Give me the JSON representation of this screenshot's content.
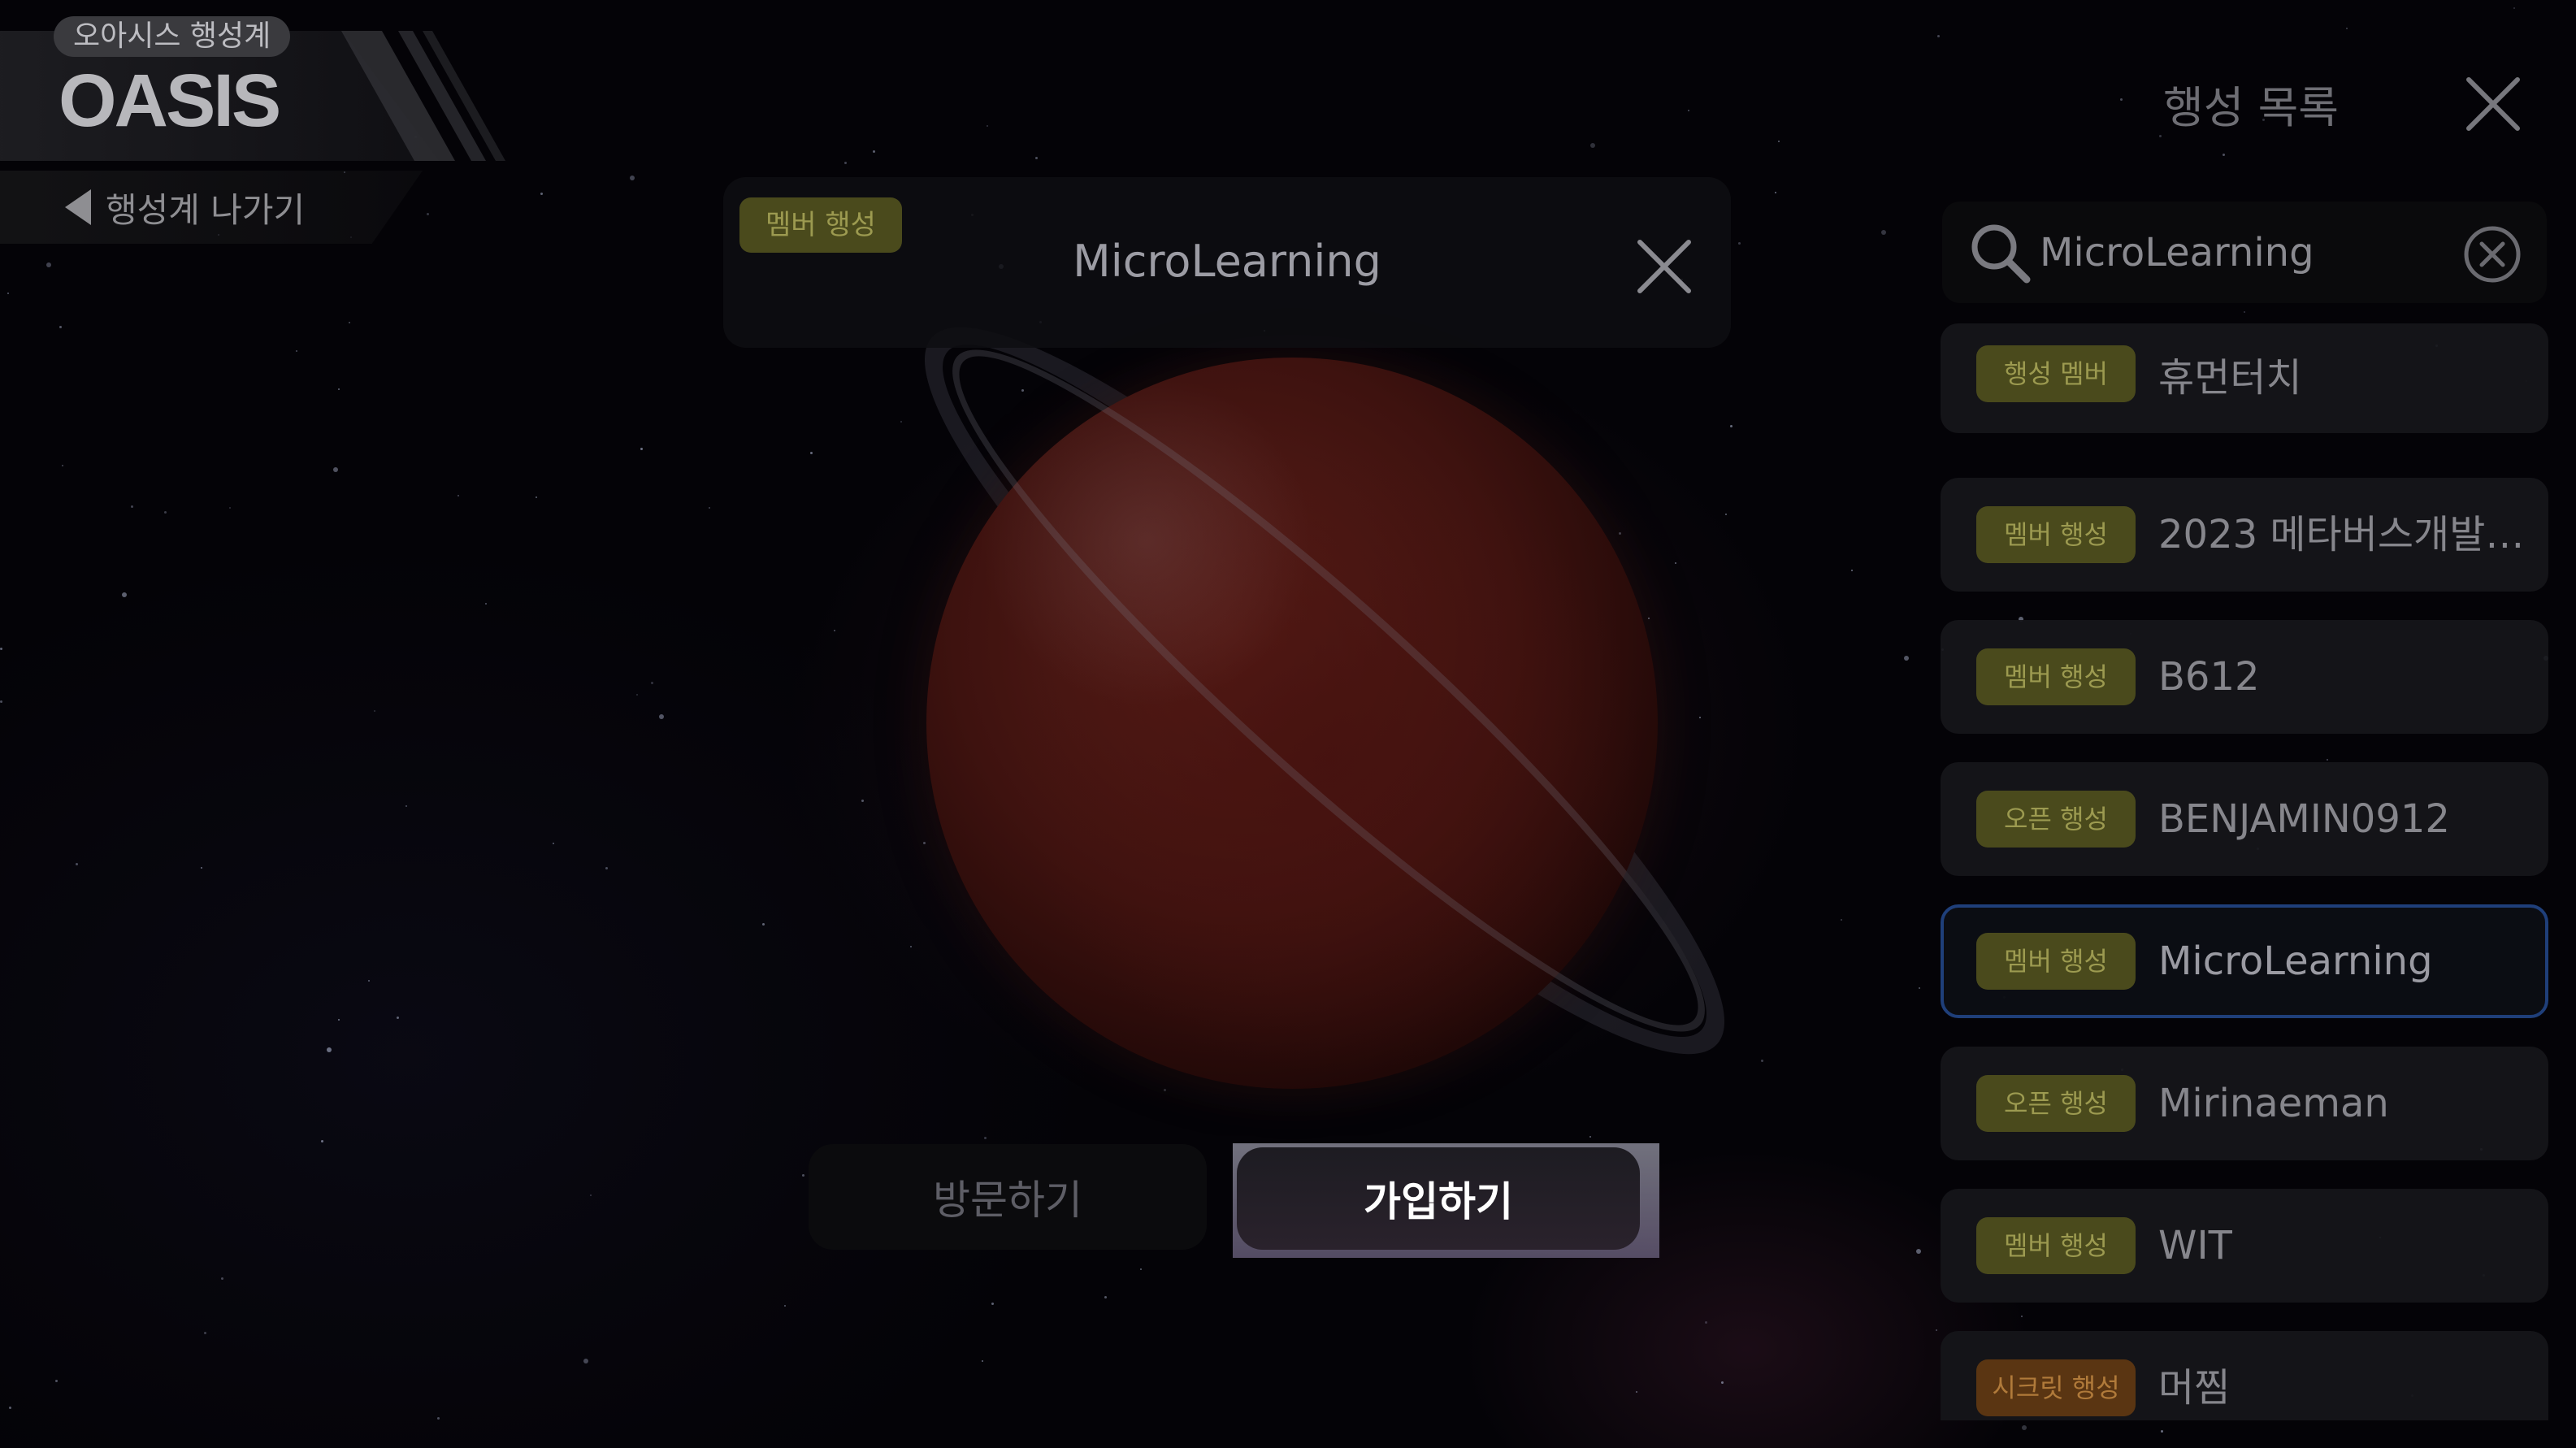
{
  "logo": {
    "badge": "오아시스 행성계",
    "name": "OASIS"
  },
  "back": {
    "label": "행성계 나가기"
  },
  "info_card": {
    "badge": "멤버 행성",
    "title": "MicroLearning"
  },
  "actions": {
    "visit_label": "방문하기",
    "join_label": "가입하기"
  },
  "panel": {
    "title": "행성 목록",
    "search_value": "MicroLearning",
    "items": [
      {
        "tag": "행성 멤버",
        "tag_type": "member",
        "name": "휴먼터치",
        "selected": false
      },
      {
        "tag": "멤버 행성",
        "tag_type": "member",
        "name": "2023 메타버스개발…",
        "selected": false
      },
      {
        "tag": "멤버 행성",
        "tag_type": "member",
        "name": "B612",
        "selected": false
      },
      {
        "tag": "오픈 행성",
        "tag_type": "open",
        "name": "BENJAMIN0912",
        "selected": false
      },
      {
        "tag": "멤버 행성",
        "tag_type": "member",
        "name": "MicroLearning",
        "selected": true
      },
      {
        "tag": "오픈 행성",
        "tag_type": "open",
        "name": "Mirinaeman",
        "selected": false
      },
      {
        "tag": "멤버 행성",
        "tag_type": "member",
        "name": "WIT",
        "selected": false
      },
      {
        "tag": "시크릿 행성",
        "tag_type": "secret",
        "name": "머찜",
        "selected": false
      }
    ]
  },
  "colors": {
    "member_tag_bg": "#4a4a1c",
    "secret_tag_bg": "#5a3512",
    "selected_border": "#1f3f7a"
  }
}
